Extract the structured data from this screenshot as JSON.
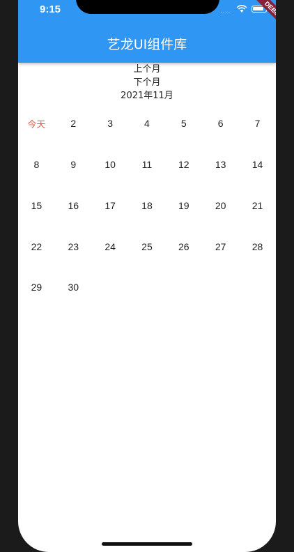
{
  "status_bar": {
    "time": "9:15",
    "signal": "....",
    "debug_label": "DEBUG"
  },
  "app_bar": {
    "title": "艺龙UI组件库"
  },
  "controls": {
    "prev_label": "上个月",
    "next_label": "下个月",
    "month_label": "2021年11月"
  },
  "calendar": {
    "weeks": [
      [
        "今天",
        "2",
        "3",
        "4",
        "5",
        "6",
        "7"
      ],
      [
        "8",
        "9",
        "10",
        "11",
        "12",
        "13",
        "14"
      ],
      [
        "15",
        "16",
        "17",
        "18",
        "19",
        "20",
        "21"
      ],
      [
        "22",
        "23",
        "24",
        "25",
        "26",
        "27",
        "28"
      ],
      [
        "29",
        "30",
        "",
        "",
        "",
        "",
        ""
      ]
    ],
    "today_color": "#e25b4a"
  },
  "colors": {
    "app_bar": "#2f96f3",
    "text": "#222222"
  }
}
